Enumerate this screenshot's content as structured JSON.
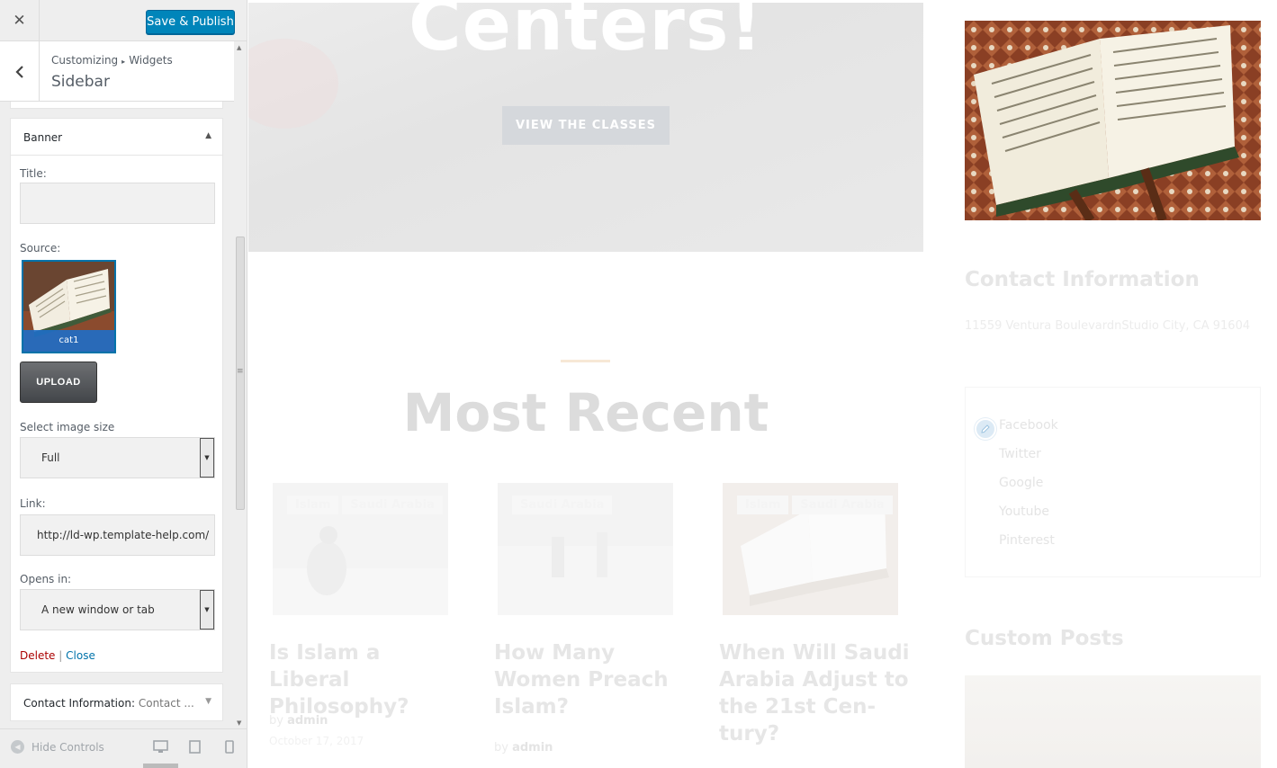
{
  "customizer": {
    "close_icon": "close-icon",
    "publish_label": "Save & Publish",
    "breadcrumb": {
      "parent": "Customizing",
      "separator": "▸",
      "child": "Widgets"
    },
    "section_title": "Sidebar",
    "banner_widget": {
      "title": "Banner",
      "title_label": "Title:",
      "title_value": "",
      "source_label": "Source:",
      "source_image_caption": "cat1",
      "upload_label": "UPLOAD",
      "image_size_label": "Select image size",
      "image_size_value": "Full",
      "link_label": "Link:",
      "link_value": "http://ld-wp.template-help.com/",
      "opens_in_label": "Opens in:",
      "opens_in_value": "A new window or tab",
      "delete_label": "Delete",
      "action_separator": "|",
      "close_label": "Close"
    },
    "contact_widget": {
      "title": "Contact Information:",
      "subtitle": "Contact ..."
    },
    "footer": {
      "hide_controls_label": "Hide Controls",
      "devices": [
        "desktop-icon",
        "tablet-icon",
        "mobile-icon"
      ]
    },
    "accent_color": "#0085ba"
  },
  "preview": {
    "hero_heading": "Centers!",
    "hero_button": "VIEW THE CLASSES",
    "recent_heading": "Most Recent",
    "posts": [
      {
        "tags": [
          "Islam",
          "Saudi Arabia"
        ],
        "title": "Is Islam a Liberal Philosophy?",
        "by": "by",
        "author": "admin",
        "date": "October 17, 2017"
      },
      {
        "tags": [
          "Saudi Arabia"
        ],
        "title": "How Many Women Preach Islam?",
        "by": "by",
        "author": "admin",
        "date": ""
      },
      {
        "tags": [
          "Islam",
          "Saudi Arabia"
        ],
        "title": "When Will Saudi Arabia Adjust to the 21st Cen-tury?",
        "by": "",
        "author": "",
        "date": ""
      }
    ],
    "sidebar": {
      "contact_heading": "Contact Information",
      "contact_address": "11559 Ventura BoulevardnStudio City, CA 91604",
      "social_links": [
        "Facebook",
        "Twitter",
        "Google",
        "Youtube",
        "Pinterest"
      ],
      "custom_posts_heading": "Custom Posts"
    }
  }
}
